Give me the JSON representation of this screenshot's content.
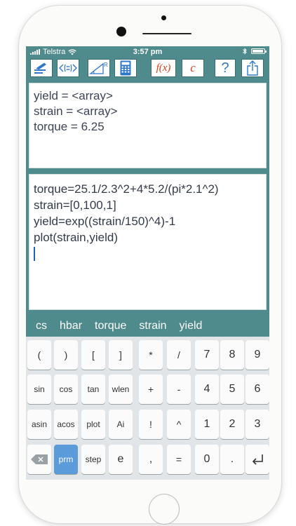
{
  "status": {
    "carrier": "Telstra",
    "time": "3:57 pm"
  },
  "toolbar": {
    "buttons": [
      {
        "name": "edit-notes",
        "icon": "pencil-notes-icon"
      },
      {
        "name": "matrix",
        "icon": "matrix-bracket-icon",
        "label": "(:::)"
      },
      {
        "name": "angle-mode",
        "icon": "angle-R-icon",
        "label": "R"
      },
      {
        "name": "calculator",
        "icon": "calculator-icon"
      },
      {
        "name": "functions",
        "label": "f(x)"
      },
      {
        "name": "constants",
        "label": "c"
      },
      {
        "name": "help",
        "label": "?"
      },
      {
        "name": "share",
        "icon": "share-icon"
      }
    ],
    "accent_red": "#d0421b",
    "accent_blue": "#2f78c9"
  },
  "results": {
    "lines": [
      "yield = <array>",
      "strain = <array>",
      "torque = 6.25"
    ]
  },
  "editor": {
    "lines": [
      "torque=25.1/2.3^2+4*5.2/(pi*2.1^2)",
      "strain=[0,100,1]",
      "yield=exp((strain/150)^4)-1",
      "plot(strain,yield)"
    ]
  },
  "variables": [
    "cs",
    "hbar",
    "torque",
    "strain",
    "yield"
  ],
  "keypad": {
    "rows": [
      [
        "(",
        ")",
        "[",
        "]",
        "*",
        "/",
        "7",
        "8",
        "9"
      ],
      [
        "sin",
        "cos",
        "tan",
        "wlen",
        "+",
        "-",
        "4",
        "5",
        "6"
      ],
      [
        "asin",
        "acos",
        "plot",
        "Ai",
        "!",
        "^",
        "1",
        "2",
        "3"
      ],
      [
        "⌫",
        "prm",
        "step",
        "e",
        ",",
        "=",
        "0",
        ".",
        "↵"
      ]
    ]
  },
  "colors": {
    "theme": "#4f8a8c",
    "keypad_bg": "#e1e5e7",
    "prm_key": "#5b9bd9"
  }
}
